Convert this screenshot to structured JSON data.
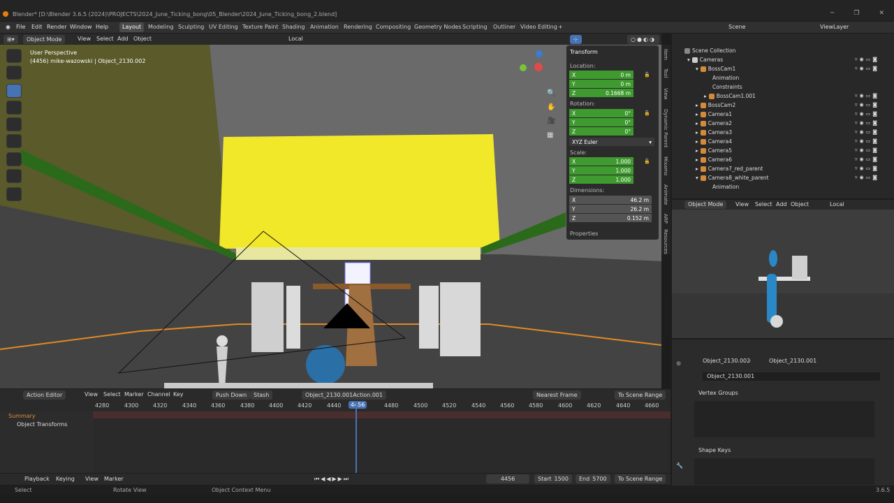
{
  "title": "Blender* [D:\\Blender 3.6.5 (2024)\\PROJECTS\\2024_June_Ticking_bong\\05_Blender\\2024_June_Ticking_bong_2.blend]",
  "menu": [
    "File",
    "Edit",
    "Render",
    "Window",
    "Help"
  ],
  "workspaces": [
    "Layout",
    "Modeling",
    "Sculpting",
    "UV Editing",
    "Texture Paint",
    "Shading",
    "Animation",
    "Rendering",
    "Compositing",
    "Geometry Nodes",
    "Scripting",
    "Outliner",
    "Video Editing",
    "+"
  ],
  "vp_header": {
    "mode": "Object Mode",
    "menus": [
      "View",
      "Select",
      "Add",
      "Object"
    ],
    "orientation": "Local"
  },
  "viewport": {
    "perspective": "User Perspective",
    "info": "(4456) mike-wazowski | Object_2130.002"
  },
  "npanel": {
    "transform": "Transform",
    "location": "Location:",
    "loc": [
      [
        "X",
        "0 m"
      ],
      [
        "Y",
        "0 m"
      ],
      [
        "Z",
        "0.1668 m"
      ]
    ],
    "rotation": "Rotation:",
    "rot": [
      [
        "X",
        "0°"
      ],
      [
        "Y",
        "0°"
      ],
      [
        "Z",
        "0°"
      ]
    ],
    "euler": "XYZ Euler",
    "scale": "Scale:",
    "scl": [
      [
        "X",
        "1.000"
      ],
      [
        "Y",
        "1.000"
      ],
      [
        "Z",
        "1.000"
      ]
    ],
    "dimensions": "Dimensions:",
    "dim": [
      [
        "X",
        "46.2 m"
      ],
      [
        "Y",
        "26.2 m"
      ],
      [
        "Z",
        "0.152 m"
      ]
    ],
    "properties": "Properties"
  },
  "ntabs": [
    "Item",
    "Tool",
    "View",
    "Dynamic Parent",
    "Mixamo",
    "Animate",
    "ARP",
    "Resources"
  ],
  "outliner": {
    "scene": "Scene",
    "viewlayer": "ViewLayer",
    "items": [
      "Scene Collection",
      "Cameras",
      "BossCam1",
      "Animation",
      "Constraints",
      "BossCam1.001",
      "BossCam2",
      "Camera1",
      "Camera2",
      "Camera3",
      "Camera4",
      "Camera5",
      "Camera6",
      "Camera7_red_parent",
      "Camera8_white_parent",
      "Animation"
    ]
  },
  "vp2": {
    "mode": "Object Mode",
    "menus": [
      "View",
      "Select",
      "Add",
      "Object"
    ],
    "orientation": "Local"
  },
  "props": {
    "path1": "Object_2130.002",
    "path2": "Object_2130.001",
    "mesh": "Object_2130.001",
    "vertex_groups": "Vertex Groups",
    "shape_keys": "Shape Keys"
  },
  "dopesheet": {
    "editor": "Action Editor",
    "menus": [
      "View",
      "Select",
      "Marker",
      "Channel",
      "Key"
    ],
    "push_down": "Push Down",
    "stash": "Stash",
    "action": "Object_2130.001Action.001",
    "snap": "Nearest Frame",
    "range": "To Scene Range",
    "ticks": [
      "4280",
      "4300",
      "4320",
      "4340",
      "4360",
      "4380",
      "4400",
      "4420",
      "4440",
      "4456",
      "4480",
      "4500",
      "4520",
      "4540",
      "4560",
      "4580",
      "4600",
      "4620",
      "4640",
      "4660"
    ],
    "summary": "Summary",
    "channel": "Object Transforms"
  },
  "timeline": {
    "menus": [
      "Playback",
      "Keying",
      "View",
      "Marker"
    ],
    "frame": "4456",
    "start_label": "Start",
    "start": "1500",
    "end_label": "End",
    "end": "5700",
    "range": "To Scene Range"
  },
  "status": {
    "select": "Select",
    "rotate": "Rotate View",
    "context": "Object Context Menu",
    "version": "3.6.5"
  }
}
